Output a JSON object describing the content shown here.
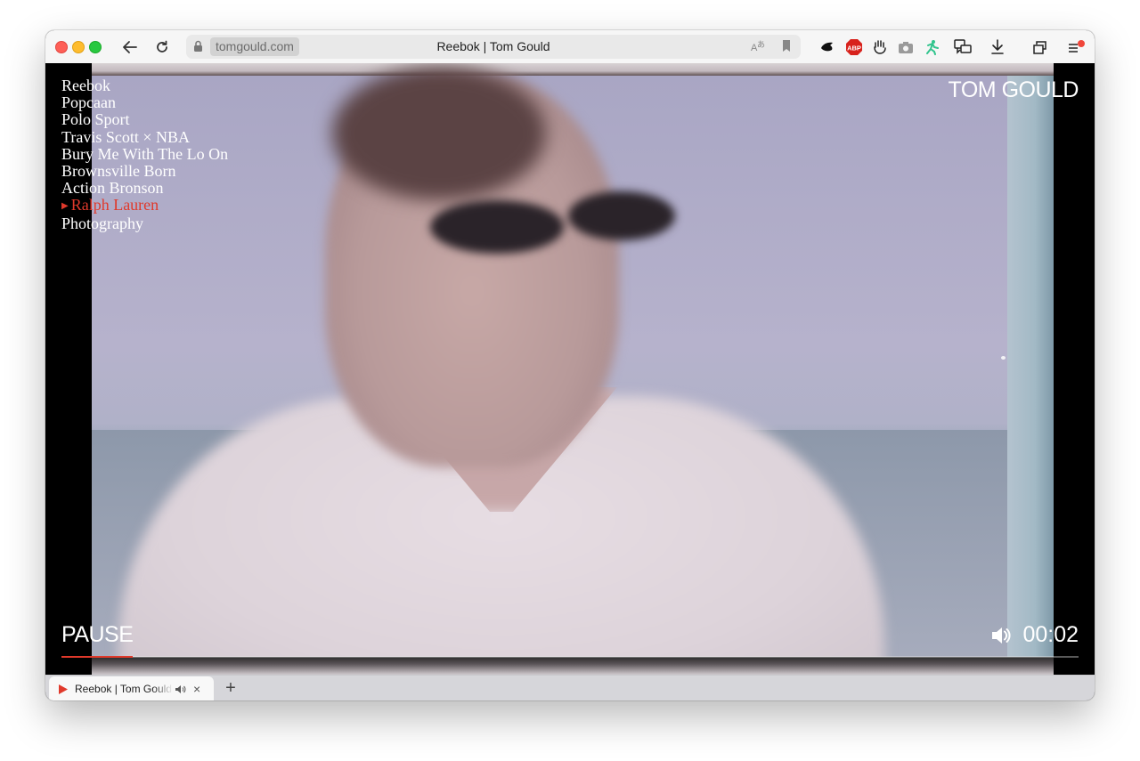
{
  "browser": {
    "domain": "tomgould.com",
    "title": "Reebok | Tom Gould",
    "tab_label": "Reebok | Tom Gould",
    "new_tab_label": "+",
    "close_tab_label": "×"
  },
  "site": {
    "brand": "TOM GOULD",
    "menu": [
      {
        "label": "Reebok",
        "active": false
      },
      {
        "label": "Popcaan",
        "active": false
      },
      {
        "label": "Polo Sport",
        "active": false
      },
      {
        "label": "Travis Scott × NBA",
        "active": false
      },
      {
        "label": "Bury Me With The Lo On",
        "active": false
      },
      {
        "label": "Brownsville Born",
        "active": false
      },
      {
        "label": "Action Bronson",
        "active": false
      },
      {
        "label": "Ralph Lauren",
        "active": true
      },
      {
        "label": "Photography",
        "active": false
      }
    ],
    "accent_color": "#e0392b"
  },
  "player": {
    "pause_label": "PAUSE",
    "time": "00:02",
    "progress": 0.07
  }
}
